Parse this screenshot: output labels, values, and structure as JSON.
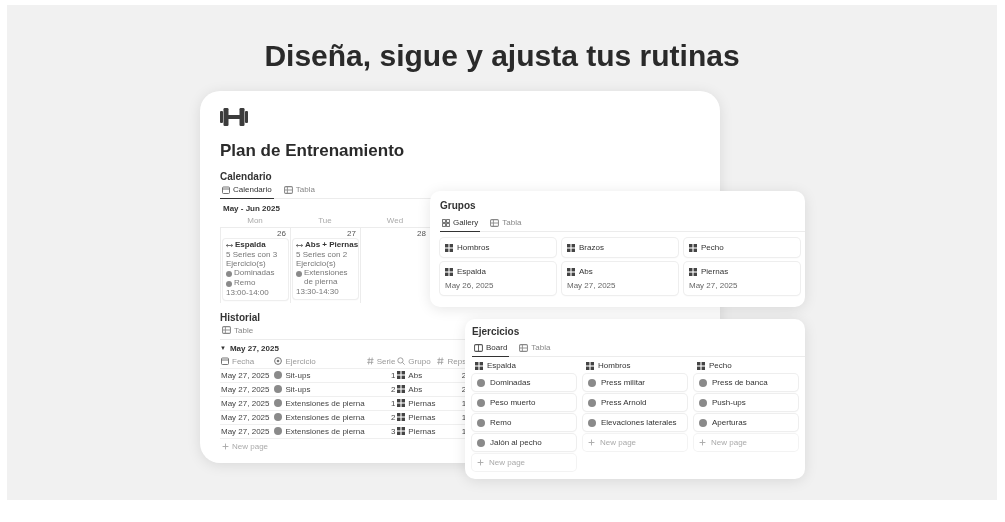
{
  "headline": "Diseña, sigue y ajusta tus rutinas",
  "plan": {
    "title": "Plan de Entrenamiento",
    "calendar": {
      "heading": "Calendario",
      "tabs": [
        {
          "label": "Calendario",
          "selected": true
        },
        {
          "label": "Tabla",
          "selected": false
        }
      ],
      "range": "May - Jun 2025",
      "weekdays": [
        "Mon",
        "Tue",
        "Wed"
      ],
      "days": [
        {
          "date": "26",
          "events": [
            {
              "title": "Espalda",
              "summary": "5 Series con 3 Ejercicio(s)",
              "tags": [
                "Dominadas",
                "Remo"
              ],
              "time": "13:00-14:00"
            }
          ]
        },
        {
          "date": "27",
          "events": [
            {
              "title": "Abs + Piernas",
              "summary": "5 Series con 2 Ejercicio(s)",
              "tags": [
                "Extensiones de pierna"
              ],
              "time": "13:30-14:30"
            }
          ]
        },
        {
          "date": "28"
        }
      ]
    },
    "history": {
      "heading": "Historial",
      "tabs": [
        {
          "label": "Table",
          "selected": false
        }
      ],
      "group": {
        "toggle": "▼",
        "label": "May 27, 2025"
      },
      "columns": [
        {
          "label": "Fecha",
          "kind": "date"
        },
        {
          "label": "Ejercicio",
          "kind": "relation"
        },
        {
          "label": "Serie",
          "kind": "number"
        },
        {
          "label": "Grupo",
          "kind": "rollup"
        },
        {
          "label": "Reps",
          "kind": "number"
        }
      ],
      "rows": [
        [
          "May 27, 2025",
          "Sit-ups",
          "1",
          "Abs",
          "2"
        ],
        [
          "May 27, 2025",
          "Sit-ups",
          "2",
          "Abs",
          "2"
        ],
        [
          "May 27, 2025",
          "Extensiones de pierna",
          "1",
          "Piernas",
          "1"
        ],
        [
          "May 27, 2025",
          "Extensiones de pierna",
          "2",
          "Piernas",
          "1"
        ],
        [
          "May 27, 2025",
          "Extensiones de pierna",
          "3",
          "Piernas",
          "1"
        ]
      ],
      "new_page": "New page"
    }
  },
  "groups": {
    "title": "Grupos",
    "tabs": [
      {
        "label": "Gallery",
        "selected": true
      },
      {
        "label": "Tabla",
        "selected": false
      }
    ],
    "cards": [
      {
        "name": "Hombros"
      },
      {
        "name": "Brazos"
      },
      {
        "name": "Pecho"
      },
      {
        "name": "Espalda",
        "date": "May 26, 2025"
      },
      {
        "name": "Abs",
        "date": "May 27, 2025"
      },
      {
        "name": "Piernas",
        "date": "May 27, 2025"
      }
    ]
  },
  "exercises": {
    "title": "Ejercicios",
    "tabs": [
      {
        "label": "Board",
        "selected": true
      },
      {
        "label": "Tabla",
        "selected": false
      }
    ],
    "columns": [
      {
        "group": "Espalda",
        "items": [
          "Dominadas",
          "Peso muerto",
          "Remo",
          "Jalón al pecho"
        ],
        "new_page": "New page"
      },
      {
        "group": "Hombros",
        "items": [
          "Press militar",
          "Press Arnold",
          "Elevaciones laterales"
        ],
        "new_page": "New page"
      },
      {
        "group": "Pecho",
        "items": [
          "Press de banca",
          "Push-ups",
          "Aperturas"
        ],
        "new_page": "New page"
      }
    ]
  }
}
